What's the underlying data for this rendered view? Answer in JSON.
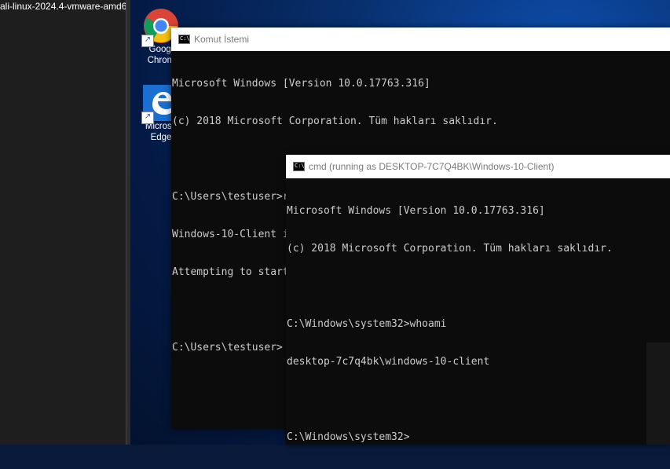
{
  "vm_panel": {
    "title": "ali-linux-2024.4-vmware-amd6"
  },
  "desktop_icons": [
    {
      "name": "chrome",
      "label_line1": "Googl",
      "label_line2": "Chrom"
    },
    {
      "name": "edge",
      "label_line1": "Microso",
      "label_line2": "Edge"
    }
  ],
  "window1": {
    "title": "Komut İstemi",
    "lines": [
      "Microsoft Windows [Version 10.0.17763.316]",
      "(c) 2018 Microsoft Corporation. Tüm hakları saklıdır.",
      "",
      "C:\\Users\\testuser>runas /user:Windows-10-Client cmd",
      "Windows-10-Client için parolayı girin:",
      "Attempting to start cmd as user \"DESKTOP-7C7Q4BK\\Windows-10-Client\" ...",
      "",
      "C:\\Users\\testuser>"
    ]
  },
  "window2": {
    "title": "cmd (running as DESKTOP-7C7Q4BK\\Windows-10-Client)",
    "lines": [
      "Microsoft Windows [Version 10.0.17763.316]",
      "(c) 2018 Microsoft Corporation. Tüm hakları saklıdır.",
      "",
      "C:\\Windows\\system32>whoami",
      "desktop-7c7q4bk\\windows-10-client",
      "",
      "C:\\Windows\\system32>"
    ]
  },
  "colors": {
    "console_bg": "#0c0c0c",
    "console_text": "#cccccc",
    "titlebar_bg": "#ffffff",
    "titlebar_text": "#7a7a7a"
  }
}
